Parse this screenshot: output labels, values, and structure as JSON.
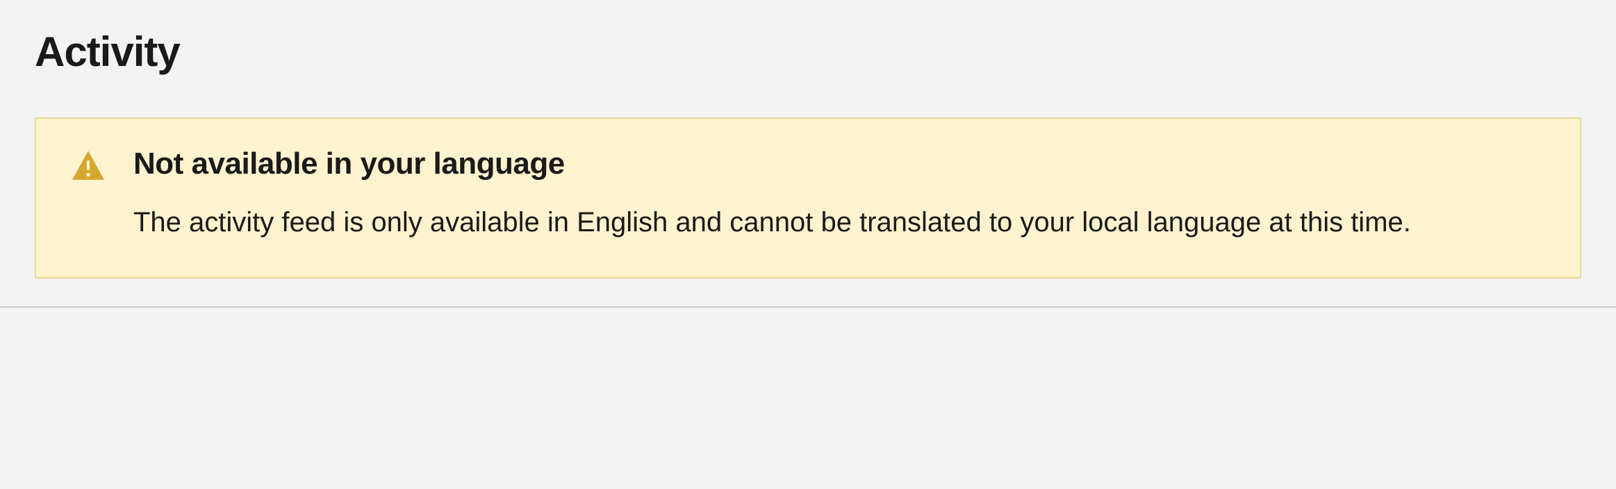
{
  "page": {
    "title": "Activity"
  },
  "alert": {
    "icon_name": "warning-triangle",
    "title": "Not available in your language",
    "message": "The activity feed is only available in English and cannot be translated to your local language at this time.",
    "colors": {
      "background": "#fdf3ce",
      "border": "#e8d998",
      "icon": "#d4a82e"
    }
  }
}
